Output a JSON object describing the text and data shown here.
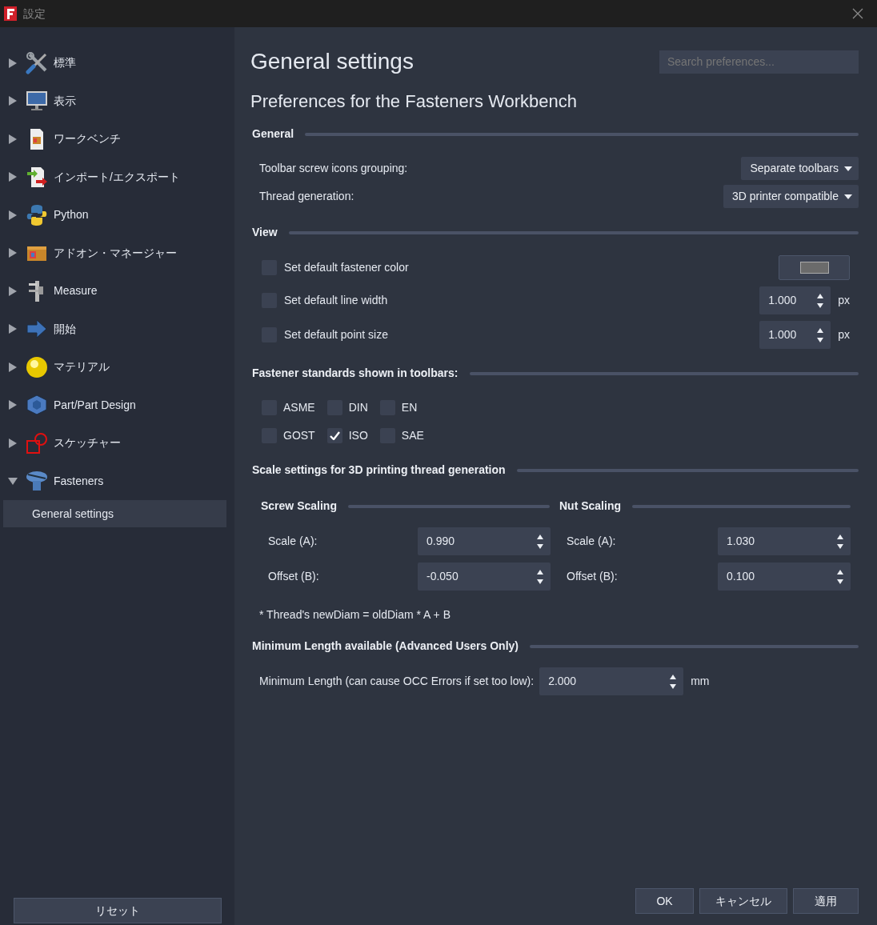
{
  "window": {
    "title": "設定"
  },
  "sidebar": {
    "items": [
      {
        "label": "標準",
        "expanded": false
      },
      {
        "label": "表示",
        "expanded": false
      },
      {
        "label": "ワークベンチ",
        "expanded": false
      },
      {
        "label": "インポート/エクスポート",
        "expanded": false
      },
      {
        "label": "Python",
        "expanded": false
      },
      {
        "label": "アドオン・マネージャー",
        "expanded": false
      },
      {
        "label": "Measure",
        "expanded": false
      },
      {
        "label": "開始",
        "expanded": false
      },
      {
        "label": "マテリアル",
        "expanded": false
      },
      {
        "label": "Part/Part Design",
        "expanded": false
      },
      {
        "label": "スケッチャー",
        "expanded": false
      },
      {
        "label": "Fasteners",
        "expanded": true,
        "children": [
          {
            "label": "General settings",
            "selected": true
          }
        ]
      }
    ],
    "reset_button": "リセット"
  },
  "search": {
    "placeholder": "Search preferences..."
  },
  "page": {
    "title": "General settings",
    "subtitle": "Preferences for the Fasteners Workbench"
  },
  "sections": [
    {
      "kind": "rows",
      "title": "General",
      "rows": [
        {
          "kind": "combo",
          "label": "Toolbar screw icons grouping:",
          "value": "Separate toolbars"
        },
        {
          "kind": "combo",
          "label": "Thread generation:",
          "value": "3D printer compatible"
        }
      ]
    },
    {
      "kind": "rows",
      "title": "View",
      "rows": [
        {
          "kind": "color",
          "label": "Set default fastener color",
          "checked": false
        },
        {
          "kind": "spin",
          "label": "Set default line width",
          "checked": false,
          "value": "1.000",
          "unit": "px"
        },
        {
          "kind": "spin",
          "label": "Set default point size",
          "checked": false,
          "value": "1.000",
          "unit": "px"
        }
      ]
    },
    {
      "kind": "checks",
      "title": "Fastener standards shown in toolbars:",
      "lines": [
        [
          {
            "label": "ASME",
            "checked": false
          },
          {
            "label": "DIN",
            "checked": false
          },
          {
            "label": "EN",
            "checked": false
          }
        ],
        [
          {
            "label": "GOST",
            "checked": false
          },
          {
            "label": "ISO",
            "checked": true
          },
          {
            "label": "SAE",
            "checked": false
          }
        ]
      ]
    },
    {
      "kind": "scale",
      "title": "Scale settings for 3D printing thread generation",
      "groups": [
        {
          "title": "Screw Scaling",
          "fields": [
            {
              "label": "Scale (A):",
              "value": "0.990"
            },
            {
              "label": "Offset (B):",
              "value": "-0.050"
            }
          ]
        },
        {
          "title": "Nut Scaling",
          "fields": [
            {
              "label": "Scale (A):",
              "value": "1.030"
            },
            {
              "label": "Offset (B):",
              "value": "0.100"
            }
          ]
        }
      ],
      "note": "* Thread's newDiam = oldDiam * A + B"
    },
    {
      "kind": "minlen",
      "title": "Minimum Length available (Advanced Users Only)",
      "label": "Minimum Length (can cause OCC Errors if set too low):",
      "value": "2.000",
      "unit": "mm"
    }
  ],
  "buttons": [
    "OK",
    "キャンセル",
    "適用"
  ]
}
